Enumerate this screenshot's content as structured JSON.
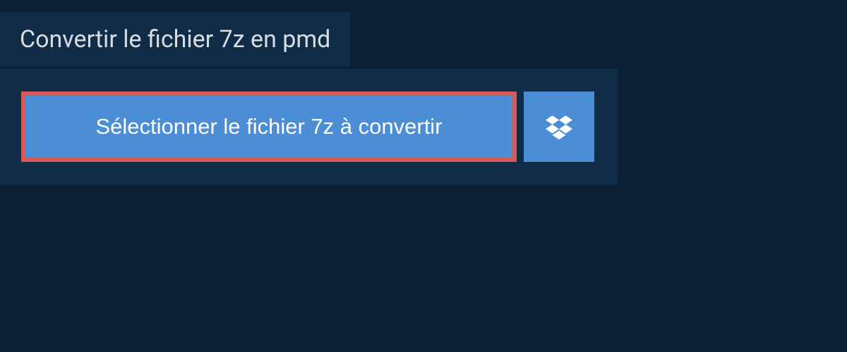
{
  "header": {
    "title": "Convertir le fichier 7z en pmd"
  },
  "actions": {
    "select_file_label": "Sélectionner le fichier 7z à convertir"
  }
}
